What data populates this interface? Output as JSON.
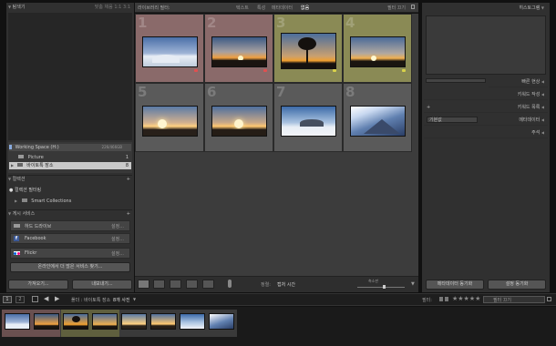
{
  "left": {
    "navigator_title": "탐색기",
    "navigator_modes": "맞춤  채움  1:1  3:1",
    "catalog": {
      "folder_root": "Working Space (H:)",
      "folder_size": "226/466GB",
      "folders": [
        {
          "label": "Picture",
          "count": "1"
        },
        {
          "label": "바이토톡 장소",
          "count": "8"
        }
      ]
    },
    "collections": {
      "title": "컬렉션",
      "items": [
        "컬렉션 필터링",
        "Smart Collections"
      ]
    },
    "publish": {
      "title": "게시 서비스",
      "services": [
        {
          "label": "하드 드라이브",
          "action": "설정..."
        },
        {
          "label": "Facebook",
          "action": "설정..."
        },
        {
          "label": "Flickr",
          "action": "설정..."
        }
      ],
      "find_more": "온라인에서 더 많은 서비스 찾기..."
    },
    "import_label": "가져오기...",
    "export_label": "내보내기..."
  },
  "center": {
    "filter_title": "라이브러리 필터:",
    "filter_tabs": [
      "텍스트",
      "특성",
      "메타데이터",
      "없음"
    ],
    "filter_preset": "필터 끄기",
    "cells": [
      {
        "num": "1",
        "bg": "#8a6a6a",
        "label_color": "#e05050"
      },
      {
        "num": "2",
        "bg": "#8a6a6a",
        "label_color": "#e05050"
      },
      {
        "num": "3",
        "bg": "#8a8a55",
        "label_color": "#d9d24a"
      },
      {
        "num": "4",
        "bg": "#8a8a55",
        "label_color": "#d9d24a"
      },
      {
        "num": "5",
        "bg": "#5a5a5a",
        "label_color": ""
      },
      {
        "num": "6",
        "bg": "#5a5a5a",
        "label_color": ""
      },
      {
        "num": "7",
        "bg": "#5a5a5a",
        "label_color": ""
      },
      {
        "num": "8",
        "bg": "#5a5a5a",
        "label_color": ""
      }
    ],
    "toolbar": {
      "sort_label": "정렬:",
      "sort_value": "캡처 시간",
      "thumb_label": "축소판"
    }
  },
  "right": {
    "histogram_title": "히스토그램",
    "sections": [
      "빠른 현상",
      "키워드 작성",
      "키워드 목록",
      "메타데이터",
      "주석"
    ],
    "metadata_preset": "기본값",
    "sync_metadata": "메타데이터 동기화",
    "sync_settings": "설정 동기화"
  },
  "filmstrip": {
    "page_a": "1",
    "page_b": "2",
    "source": "폴더 : 바이토톡 장소",
    "count": "8개 사진",
    "filter_label": "필터:",
    "filter_value": "필터 끄기"
  },
  "colors": {
    "red_label": "#e05050",
    "yellow_label": "#d9d24a"
  }
}
